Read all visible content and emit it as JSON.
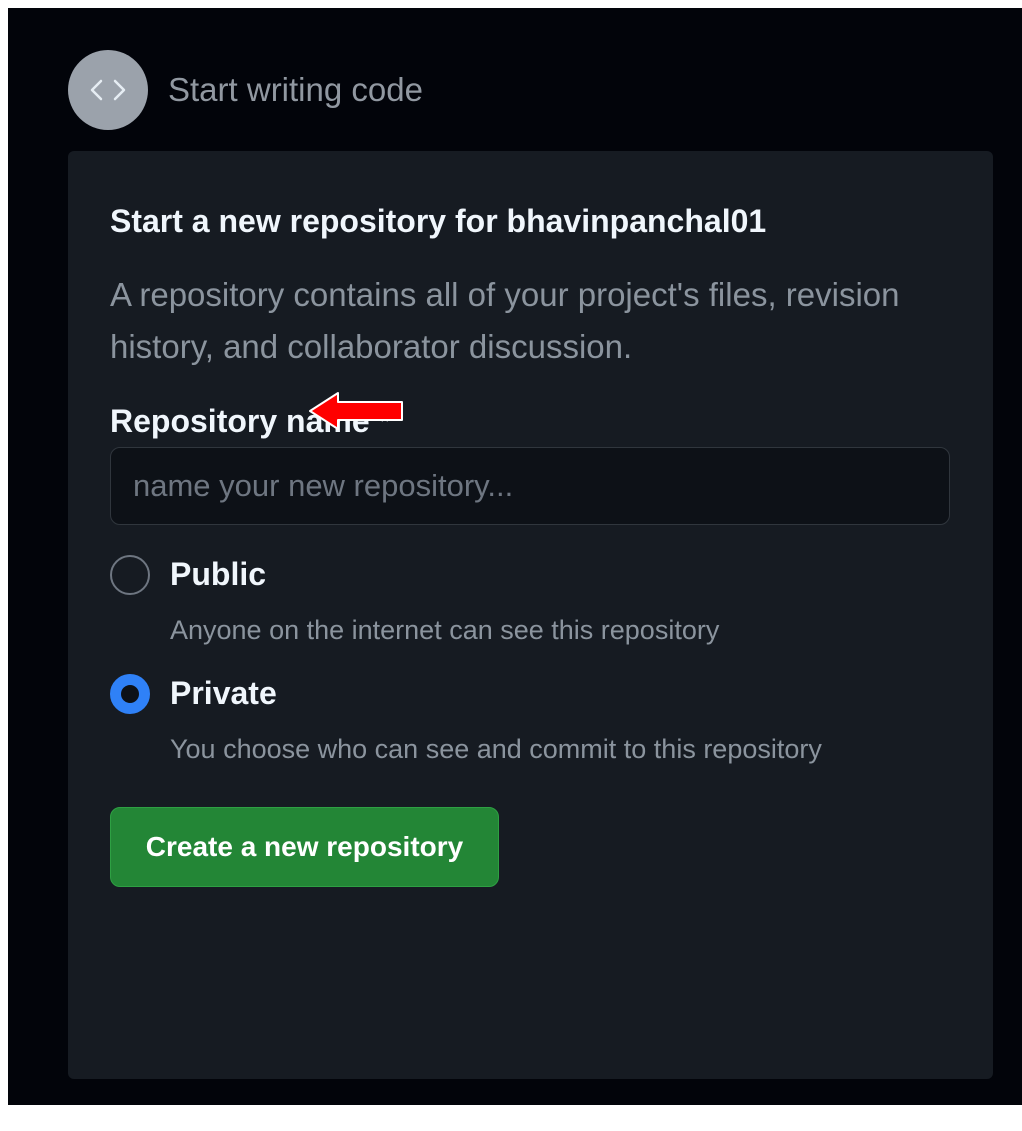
{
  "step": {
    "icon": "code-icon",
    "title": "Start writing code"
  },
  "card": {
    "title": "Start a new repository for bhavinpanchal01",
    "description": "A repository contains all of your project's files, revision history, and collaborator discussion.",
    "repo_name_label": "Repository name *",
    "repo_name_placeholder": "name your new repository...",
    "repo_name_value": ""
  },
  "visibility": {
    "selected": "Private",
    "options": [
      {
        "label": "Public",
        "description": "Anyone on the internet can see this repository",
        "icon": "radio-unchecked-icon"
      },
      {
        "label": "Private",
        "description": "You choose who can see and commit to this repository",
        "icon": "radio-checked-icon"
      }
    ]
  },
  "create_button": {
    "label": "Create a new repository"
  },
  "annotation": {
    "icon": "red-arrow-left-icon"
  },
  "colors": {
    "background": "#02040a",
    "card": "#161b22",
    "accent_blue": "#2f81f7",
    "button_green": "#238636",
    "arrow_red": "#ff0000"
  }
}
